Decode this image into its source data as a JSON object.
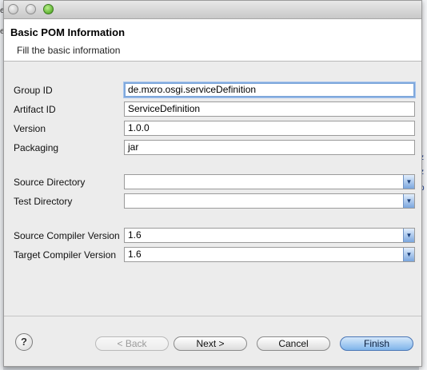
{
  "header": {
    "title": "Basic POM Information",
    "subtitle": "Fill the basic information"
  },
  "fields": {
    "group_id": {
      "label": "Group ID",
      "value": "de.mxro.osgi.serviceDefinition"
    },
    "artifact_id": {
      "label": "Artifact ID",
      "value": "ServiceDefinition"
    },
    "version": {
      "label": "Version",
      "value": "1.0.0"
    },
    "packaging": {
      "label": "Packaging",
      "value": "jar"
    },
    "source_directory": {
      "label": "Source Directory",
      "value": ""
    },
    "test_directory": {
      "label": "Test Directory",
      "value": ""
    },
    "source_compiler_version": {
      "label": "Source Compiler Version",
      "value": "1.6"
    },
    "target_compiler_version": {
      "label": "Target Compiler Version",
      "value": "1.6"
    }
  },
  "buttons": {
    "help": "?",
    "back": "< Back",
    "next": "Next >",
    "cancel": "Cancel",
    "finish": "Finish"
  },
  "icons": {
    "dropdown": "chevron-down-icon",
    "help": "help-icon"
  },
  "colors": {
    "primary_button": "#7fb4ea",
    "focus_ring": "#7fa8dc",
    "zoom_light": "#3e9a12"
  }
}
